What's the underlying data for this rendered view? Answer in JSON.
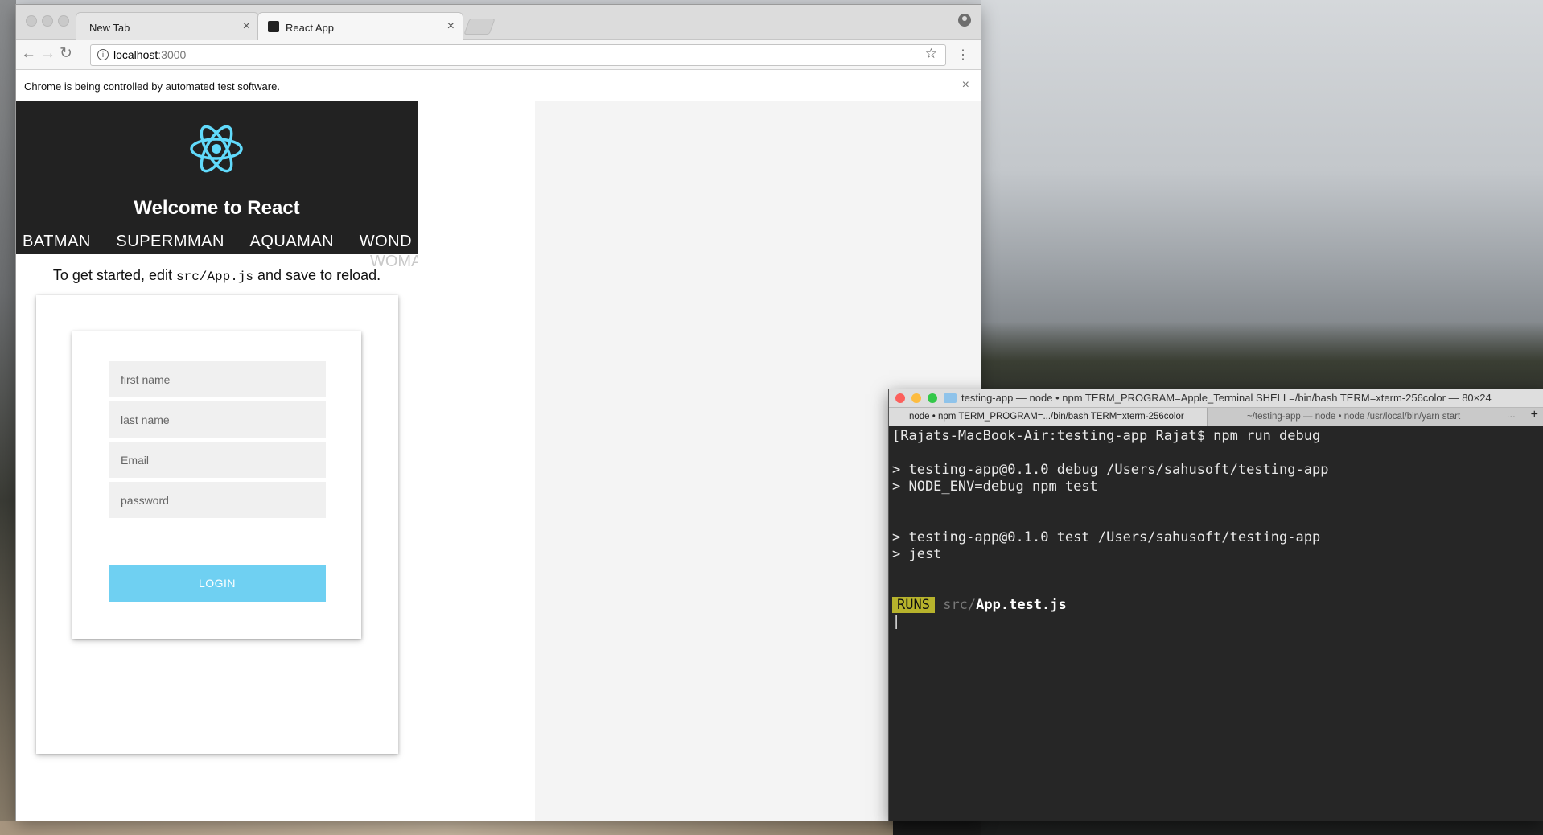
{
  "browser": {
    "tabs": [
      {
        "label": "New Tab"
      },
      {
        "label": "React App"
      }
    ],
    "address": {
      "host": "localhost",
      "port": ":3000"
    },
    "infobar": {
      "message": "Chrome is being controlled by automated test software."
    }
  },
  "app": {
    "title": "Welcome to React",
    "nav": [
      "BATMAN",
      "SUPERMMAN",
      "AQUAMAN",
      "WOND"
    ],
    "nav_overflow": "WOMA",
    "intro_prefix": "To get started, edit ",
    "intro_code": "src/App.js",
    "intro_suffix": " and save to reload.",
    "form": {
      "first_name_placeholder": "first name",
      "last_name_placeholder": "last name",
      "email_placeholder": "Email",
      "password_placeholder": "password",
      "login_label": "LOGIN"
    },
    "colors": {
      "header_bg": "#222222",
      "login_button": "#6fd0f2",
      "react_logo": "#61dafb"
    }
  },
  "terminal": {
    "title": "testing-app — node • npm TERM_PROGRAM=Apple_Terminal SHELL=/bin/bash TERM=xterm-256color — 80×24",
    "tab1": "node • npm TERM_PROGRAM=.../bin/bash TERM=xterm-256color",
    "tab2": "~/testing-app — node • node /usr/local/bin/yarn start",
    "lines": {
      "prompt": "[Rajats-MacBook-Air:testing-app Rajat$ npm run debug",
      "l1": "> testing-app@0.1.0 debug /Users/sahusoft/testing-app",
      "l2": "> NODE_ENV=debug npm test",
      "l3": "> testing-app@0.1.0 test /Users/sahusoft/testing-app",
      "l4": "> jest",
      "runs_badge": "RUNS",
      "runs_dir": "src/",
      "runs_file": "App.test.js"
    }
  }
}
